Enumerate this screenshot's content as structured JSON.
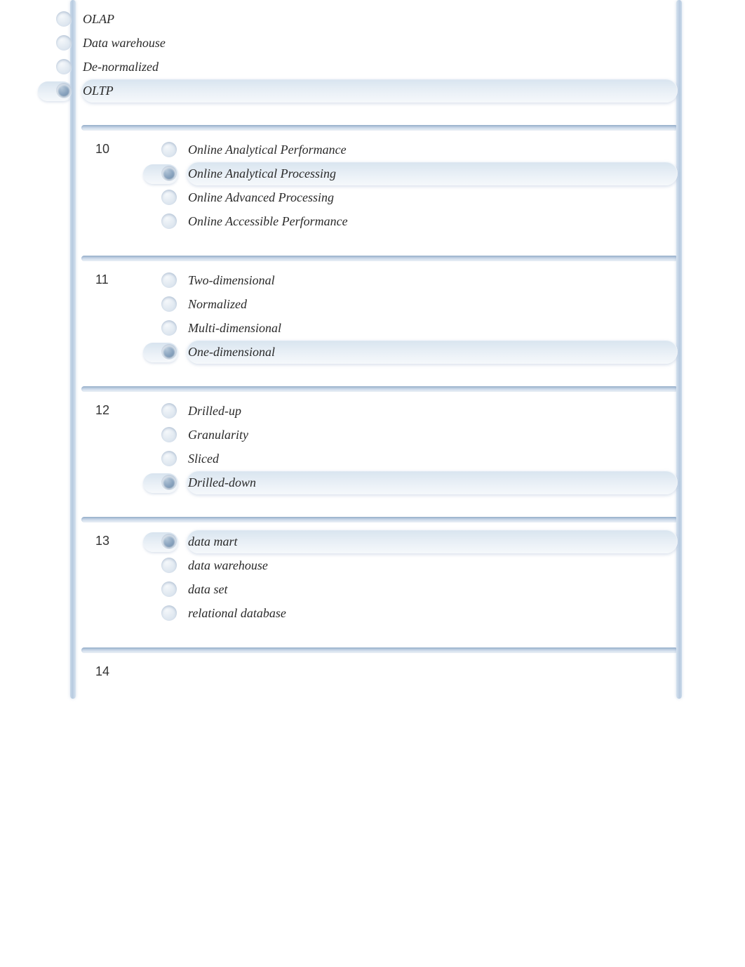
{
  "questions": [
    {
      "number": "",
      "options": [
        {
          "label": "OLAP",
          "selected": false
        },
        {
          "label": "Data warehouse",
          "selected": false
        },
        {
          "label": "De-normalized",
          "selected": false
        },
        {
          "label": "OLTP",
          "selected": true
        }
      ]
    },
    {
      "number": "10",
      "options": [
        {
          "label": "Online Analytical Performance",
          "selected": false
        },
        {
          "label": "Online Analytical Processing",
          "selected": true
        },
        {
          "label": "Online Advanced Processing",
          "selected": false
        },
        {
          "label": "Online Accessible Performance",
          "selected": false
        }
      ]
    },
    {
      "number": "11",
      "options": [
        {
          "label": "Two-dimensional",
          "selected": false
        },
        {
          "label": "Normalized",
          "selected": false
        },
        {
          "label": "Multi-dimensional",
          "selected": false
        },
        {
          "label": "One-dimensional",
          "selected": true
        }
      ]
    },
    {
      "number": "12",
      "options": [
        {
          "label": "Drilled-up",
          "selected": false
        },
        {
          "label": "Granularity",
          "selected": false
        },
        {
          "label": "Sliced",
          "selected": false
        },
        {
          "label": "Drilled-down",
          "selected": true
        }
      ]
    },
    {
      "number": "13",
      "options": [
        {
          "label": "data mart",
          "selected": true
        },
        {
          "label": "data warehouse",
          "selected": false
        },
        {
          "label": "data set",
          "selected": false
        },
        {
          "label": "relational database",
          "selected": false
        }
      ]
    },
    {
      "number": "14",
      "options": []
    }
  ]
}
